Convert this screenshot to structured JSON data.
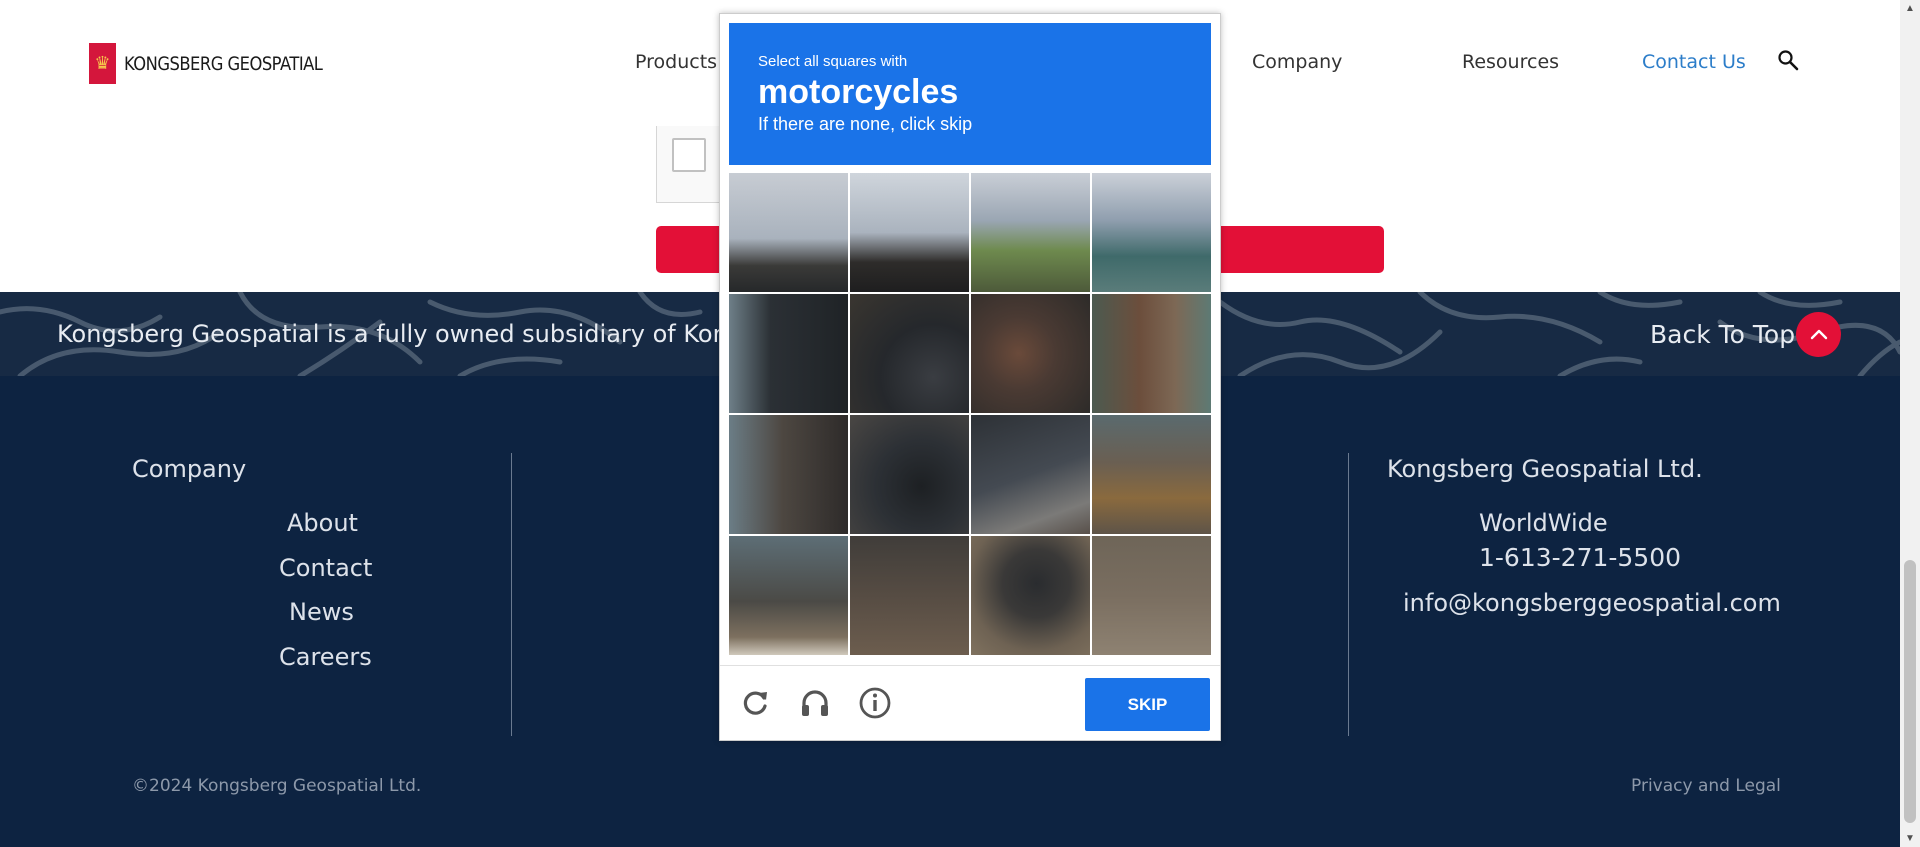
{
  "header": {
    "logo_text": "KONGSBERG GEOSPATIAL",
    "nav": [
      "Products",
      "Company",
      "Resources",
      "Contact Us"
    ]
  },
  "band": {
    "subsidiary_text": "Kongsberg Geospatial is a fully owned subsidiary of Kongsb",
    "back_to_top": "Back To Top"
  },
  "footer": {
    "company_heading": "Company",
    "company_links": [
      "About",
      "Contact",
      "News",
      "Careers"
    ],
    "ltd_heading": "Kongsberg Geospatial Ltd.",
    "region": "WorldWide",
    "phone": "1-613-271-5500",
    "email": "info@kongsberggeospatial.com",
    "copyright": "©2024 Kongsberg Geospatial Ltd.",
    "legal": "Privacy and Legal"
  },
  "captcha": {
    "instruction_line1": "Select all squares with",
    "target": "motorcycles",
    "instruction_line3": "If there are none, click skip",
    "skip_label": "SKIP",
    "accent_color": "#1a73e8",
    "footer_icons": [
      "reload-icon",
      "headphones-icon",
      "info-icon"
    ]
  },
  "colors": {
    "brand_red": "#e31037",
    "footer_navy": "#0d2341",
    "link_blue": "#2c7dc9"
  }
}
